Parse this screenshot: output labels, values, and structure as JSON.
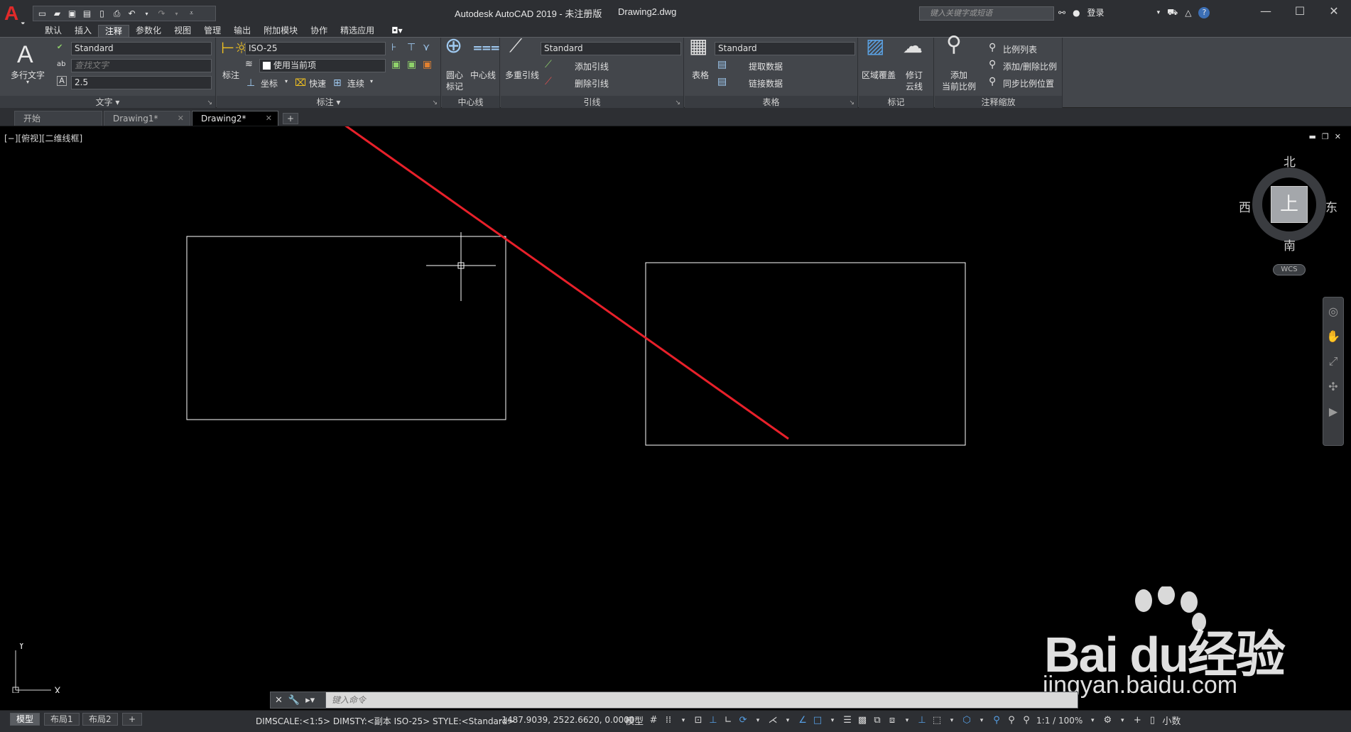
{
  "titlebar": {
    "app_logo": "A",
    "app_title": "Autodesk AutoCAD 2019 - 未注册版",
    "document": "Drawing2.dwg",
    "search_placeholder": "键入关键字或短语",
    "login_label": "登录",
    "quick_access_icons": [
      "new-file-icon",
      "open-icon",
      "save-icon",
      "save-as-icon",
      "export-icon",
      "plot-icon",
      "undo-icon",
      "redo-icon"
    ]
  },
  "ribbon_tabs": [
    "默认",
    "插入",
    "注释",
    "参数化",
    "视图",
    "管理",
    "输出",
    "附加模块",
    "协作",
    "精选应用"
  ],
  "ribbon_active_tab": "注释",
  "ribbon": {
    "text_panel": {
      "title": "文字",
      "mtext_label": "多行文字",
      "style_value": "Standard",
      "find_placeholder": "查找文字",
      "height_value": "2.5"
    },
    "dim_panel": {
      "title": "标注",
      "dim_label": "标注",
      "dimstyle_value": "ISO-25",
      "layer_value": "使用当前项",
      "ordinate_label": "坐标",
      "quick_label": "快速",
      "continue_label": "连续"
    },
    "centerline_panel": {
      "title": "中心线",
      "center_mark_label_1": "圆心",
      "center_mark_label_2": "标记",
      "centerline_label": "中心线"
    },
    "leader_panel": {
      "title": "引线",
      "mleader_label": "多重引线",
      "style_value": "Standard",
      "add_leader_label": "添加引线",
      "remove_leader_label": "删除引线"
    },
    "table_panel": {
      "title": "表格",
      "table_label": "表格",
      "style_value": "Standard",
      "extract_label": "提取数据",
      "link_label": "链接数据"
    },
    "markup_panel": {
      "title": "标记",
      "wipeout_label": "区域覆盖",
      "revcloud_label_1": "修订",
      "revcloud_label_2": "云线"
    },
    "scale_panel": {
      "title": "注释缩放",
      "add_scale_label_1": "添加",
      "add_scale_label_2": "当前比例",
      "scale_list_label": "比例列表",
      "add_delete_label": "添加/删除比例",
      "sync_label": "同步比例位置"
    }
  },
  "document_tabs": [
    {
      "label": "开始",
      "active": false
    },
    {
      "label": "Drawing1*",
      "active": false
    },
    {
      "label": "Drawing2*",
      "active": true
    }
  ],
  "viewport": {
    "label": "[−][俯视][二维线框]",
    "viewcube": {
      "north": "北",
      "south": "南",
      "east": "东",
      "west": "西",
      "face": "上",
      "wcs": "WCS"
    },
    "ucs_x": "X",
    "ucs_y": "Y"
  },
  "command_line": {
    "placeholder": "键入命令"
  },
  "watermark": {
    "brand": "Bai du经验",
    "url": "jingyan.baidu.com"
  },
  "statusbar": {
    "layout_tabs": [
      "模型",
      "布局1",
      "布局2"
    ],
    "active_layout": "模型",
    "status_text": "DIMSCALE:<1:5> DIMSTY:<副本 ISO-25> STYLE:<Standard>",
    "coordinates": "-1487.9039, 2522.6620, 0.0000",
    "mode_label": "模型",
    "scale": "1:1 / 100%",
    "units": "小数"
  },
  "colors": {
    "background": "#000000",
    "ribbon": "#43464b",
    "annotation_arrow": "#e8202a",
    "geometry": "#ffffff"
  }
}
